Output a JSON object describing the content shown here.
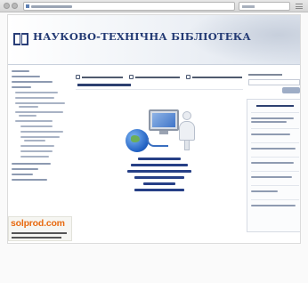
{
  "browser": {
    "back_icon": "back-arrow-icon",
    "forward_icon": "forward-arrow-icon",
    "menu_icon": "hamburger-menu-icon"
  },
  "header": {
    "title": "НАУКОВО-ТЕХНІЧНА БІБЛІОТЕКА",
    "logo_icon": "open-book-icon",
    "colors": {
      "title": "#233a74",
      "banner_end": "#dfe5ee"
    }
  },
  "ad": {
    "brand": "solprod.com",
    "brand_color": "#e86a10"
  },
  "illustration": {
    "icon": "person-computer-globe-icon"
  }
}
